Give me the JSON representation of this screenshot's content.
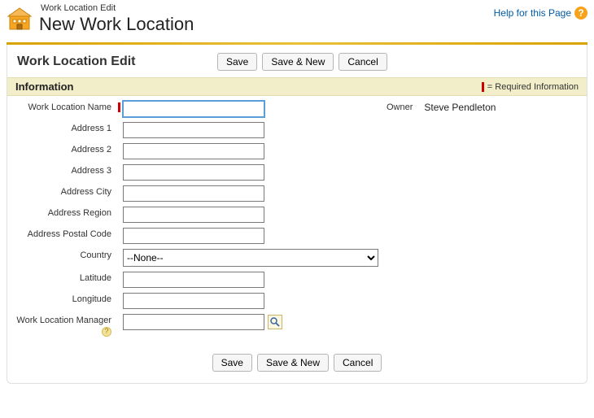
{
  "header": {
    "breadcrumb": "Work Location Edit",
    "title": "New Work Location",
    "help_text": "Help for this Page"
  },
  "section": {
    "title": "Work Location Edit"
  },
  "info_bar": {
    "title": "Information",
    "required_text": "= Required Information"
  },
  "buttons": {
    "save": "Save",
    "save_new": "Save & New",
    "cancel": "Cancel"
  },
  "fields": {
    "work_location_name": {
      "label": "Work Location Name",
      "value": "",
      "required": true
    },
    "address1": {
      "label": "Address 1",
      "value": ""
    },
    "address2": {
      "label": "Address 2",
      "value": ""
    },
    "address3": {
      "label": "Address 3",
      "value": ""
    },
    "address_city": {
      "label": "Address City",
      "value": ""
    },
    "address_region": {
      "label": "Address Region",
      "value": ""
    },
    "address_postal": {
      "label": "Address Postal Code",
      "value": ""
    },
    "country": {
      "label": "Country",
      "selected": "--None--"
    },
    "latitude": {
      "label": "Latitude",
      "value": ""
    },
    "longitude": {
      "label": "Longitude",
      "value": ""
    },
    "manager": {
      "label": "Work Location Manager",
      "value": ""
    }
  },
  "owner": {
    "label": "Owner",
    "value": "Steve Pendleton"
  }
}
